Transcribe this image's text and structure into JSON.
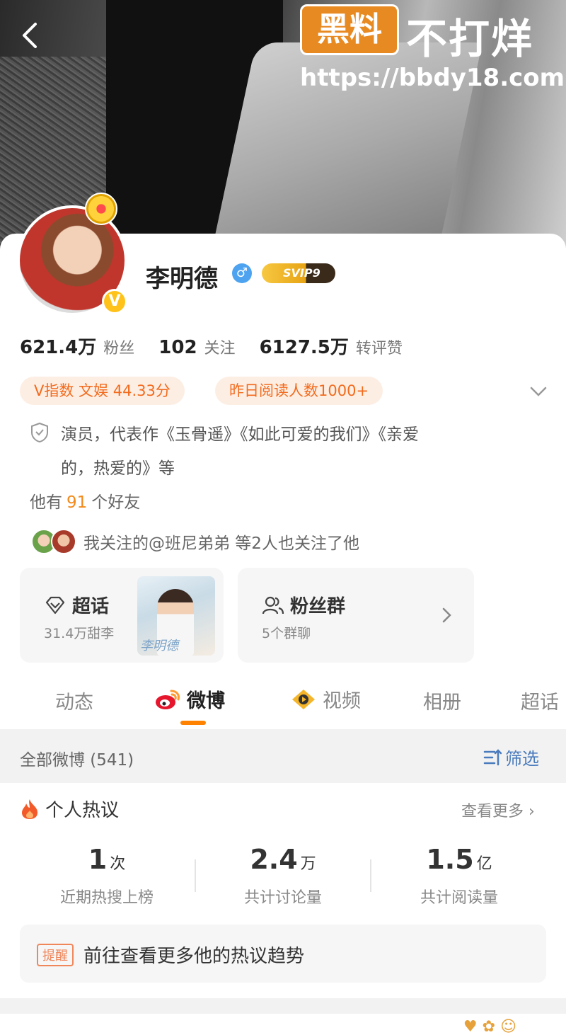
{
  "header": {
    "watermark_box": "黑料",
    "watermark_brand": "不打烊",
    "watermark_url": "https://bbdy18.com"
  },
  "profile": {
    "name": "李明德",
    "svip": "SVIP9",
    "stats": [
      {
        "value": "621.4万",
        "label": "粉丝"
      },
      {
        "value": "102",
        "label": "关注"
      },
      {
        "value": "6127.5万",
        "label": "转评赞"
      }
    ],
    "tags": [
      "V指数 文娱 44.33分",
      "昨日阅读人数1000+"
    ],
    "bio_line1": "演员，代表作《玉骨遥》《如此可爱的我们》《亲爱",
    "bio_line2": "的，热爱的》等",
    "friends_prefix": "他有",
    "friends_count": "91",
    "friends_suffix": "个好友",
    "mutual_text": "我关注的@班尼弟弟 等2人也关注了他"
  },
  "boxes": {
    "supertopic_title": "超话",
    "supertopic_sub": "31.4万甜李",
    "supertopic_thumb_caption": "李明德",
    "fangroup_title": "粉丝群",
    "fangroup_sub": "5个群聊"
  },
  "tabs": [
    "动态",
    "微博",
    "视频",
    "相册",
    "超话"
  ],
  "active_tab": "微博",
  "filter": {
    "all_label": "全部微博 (541)",
    "filter_label": "筛选"
  },
  "hot": {
    "title": "个人热议",
    "more": "查看更多 ›",
    "metrics": [
      {
        "num": "1",
        "unit": "次",
        "label": "近期热搜上榜"
      },
      {
        "num": "2.4",
        "unit": "万",
        "label": "共计讨论量"
      },
      {
        "num": "1.5",
        "unit": "亿",
        "label": "共计阅读量"
      }
    ],
    "remind_tag": "提醒",
    "remind_text": "前往查看更多他的热议趋势"
  },
  "colors": {
    "accent": "#ff8200",
    "tag_text": "#f26b1d",
    "tag_bg": "#fdeee4",
    "link_blue": "#4a7bbd"
  }
}
